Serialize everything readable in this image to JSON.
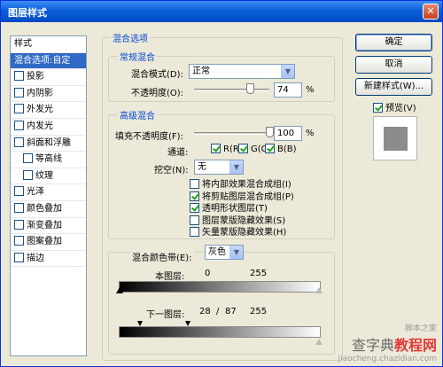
{
  "window": {
    "title": "图层样式",
    "close_glyph": "✕"
  },
  "style_list": {
    "header": "样式",
    "items": [
      {
        "label": "混合选项:自定",
        "checkbox": false,
        "selected": true,
        "sub": false,
        "checked": false
      },
      {
        "label": "投影",
        "checkbox": true,
        "selected": false,
        "sub": false,
        "checked": false
      },
      {
        "label": "内阴影",
        "checkbox": true,
        "selected": false,
        "sub": false,
        "checked": false
      },
      {
        "label": "外发光",
        "checkbox": true,
        "selected": false,
        "sub": false,
        "checked": false
      },
      {
        "label": "内发光",
        "checkbox": true,
        "selected": false,
        "sub": false,
        "checked": false
      },
      {
        "label": "斜面和浮雕",
        "checkbox": true,
        "selected": false,
        "sub": false,
        "checked": false
      },
      {
        "label": "等高线",
        "checkbox": true,
        "selected": false,
        "sub": true,
        "checked": false
      },
      {
        "label": "纹理",
        "checkbox": true,
        "selected": false,
        "sub": true,
        "checked": false
      },
      {
        "label": "光泽",
        "checkbox": true,
        "selected": false,
        "sub": false,
        "checked": false
      },
      {
        "label": "颜色叠加",
        "checkbox": true,
        "selected": false,
        "sub": false,
        "checked": false
      },
      {
        "label": "渐变叠加",
        "checkbox": true,
        "selected": false,
        "sub": false,
        "checked": false
      },
      {
        "label": "图案叠加",
        "checkbox": true,
        "selected": false,
        "sub": false,
        "checked": false
      },
      {
        "label": "描边",
        "checkbox": true,
        "selected": false,
        "sub": false,
        "checked": false
      }
    ]
  },
  "blend_options": {
    "title": "混合选项",
    "general": {
      "title": "常规混合",
      "mode_label": "混合模式(D):",
      "mode_value": "正常",
      "opacity_label": "不透明度(O):",
      "opacity_value": "74",
      "opacity_unit": "%",
      "opacity_fraction": 0.74
    },
    "advanced": {
      "title": "高级混合",
      "fill_label": "填充不透明度(F):",
      "fill_value": "100",
      "fill_unit": "%",
      "fill_fraction": 1.0,
      "channels_label": "通道:",
      "channels": [
        {
          "label": "R(R)",
          "checked": true
        },
        {
          "label": "G(G)",
          "checked": true
        },
        {
          "label": "B(B)",
          "checked": true
        }
      ],
      "knockout_label": "挖空(N):",
      "knockout_value": "无",
      "options": [
        {
          "label": "将内部效果混合成组(I)",
          "checked": false
        },
        {
          "label": "将剪贴图层混合成组(P)",
          "checked": true
        },
        {
          "label": "透明形状图层(T)",
          "checked": true
        },
        {
          "label": "图层蒙版隐藏效果(S)",
          "checked": false
        },
        {
          "label": "矢量蒙版隐藏效果(H)",
          "checked": false
        }
      ]
    },
    "blend_if": {
      "label": "混合颜色带(E):",
      "value": "灰色",
      "this_layer": {
        "label": "本图层:",
        "low": "0",
        "high": "255"
      },
      "underlying_layer": {
        "label": "下一图层:",
        "low": "28",
        "sep": "/",
        "mid": "87",
        "high": "255"
      }
    }
  },
  "buttons": {
    "ok": "确定",
    "cancel": "取消",
    "new_style": "新建样式(W)...",
    "preview_label": "预览(V)",
    "preview_checked": true
  },
  "watermark": {
    "line1": "查字典",
    "line2": "教程网",
    "line3": "脚本之家",
    "line4": "jiaocheng.chazidian.com"
  },
  "colors": {
    "titlebar": "#0a5fd8",
    "selection": "#316ac5",
    "group_title": "#0046d5"
  }
}
